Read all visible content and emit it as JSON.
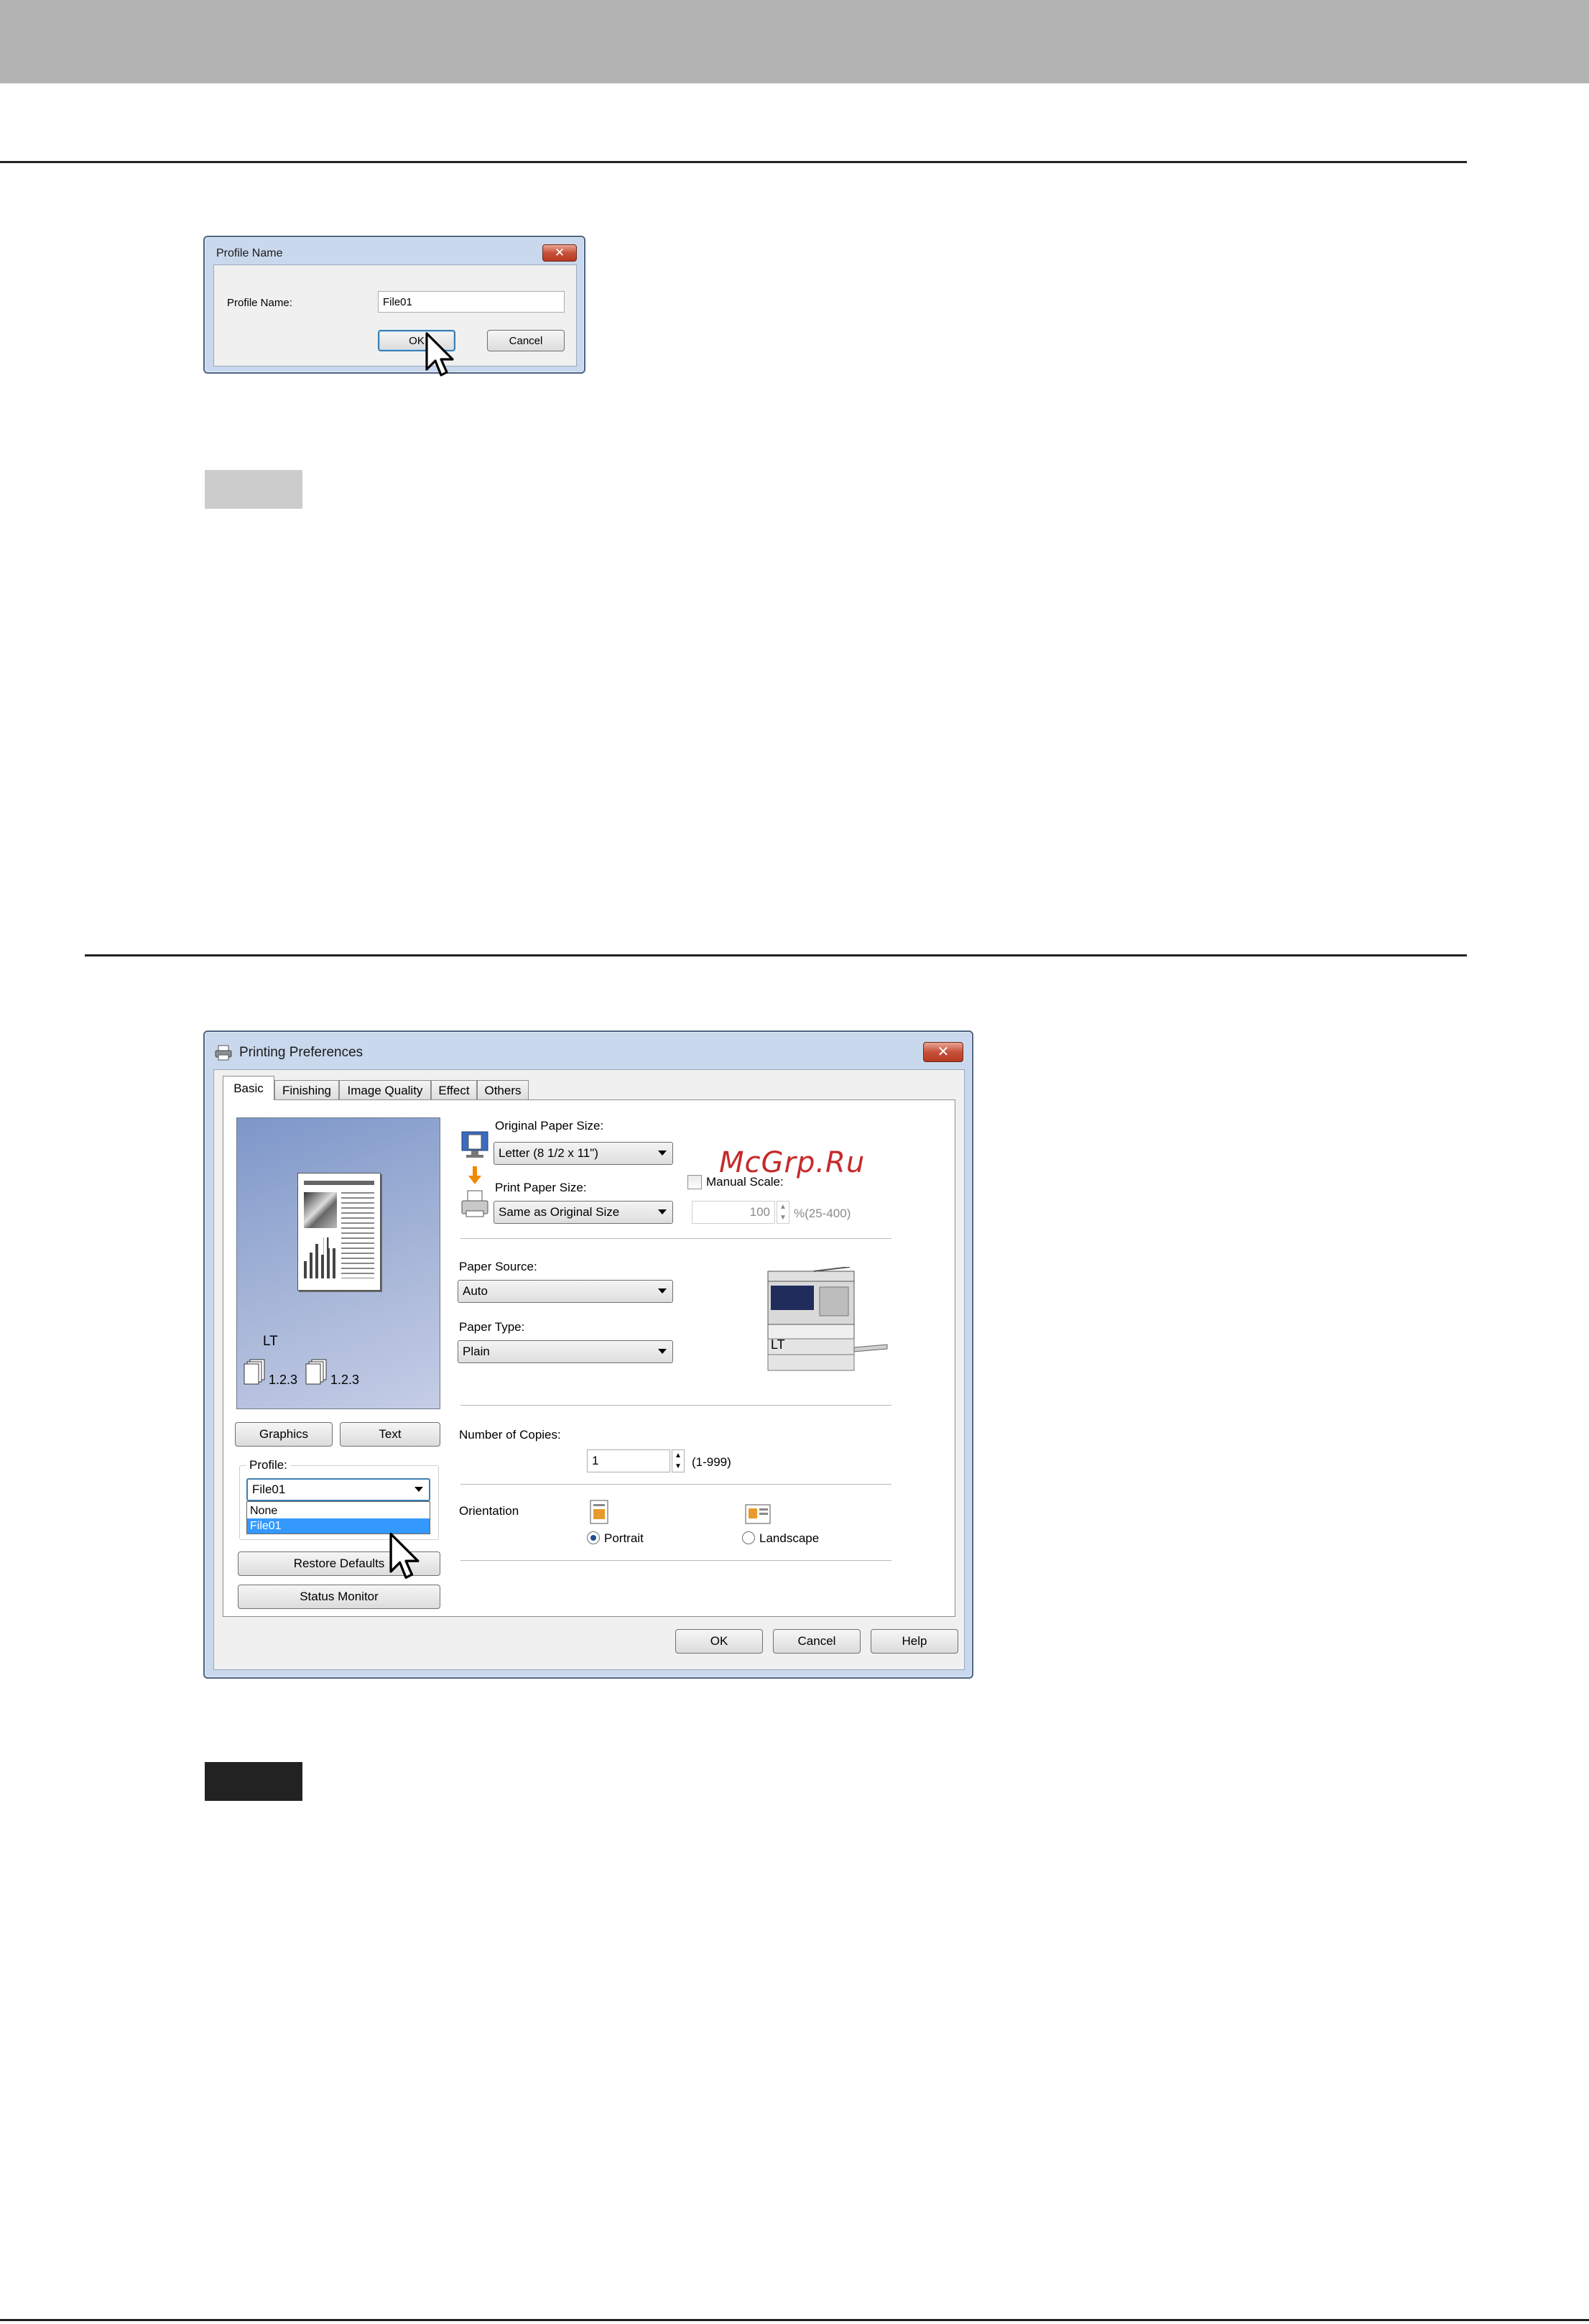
{
  "profile_name_dialog": {
    "title": "Profile Name",
    "close_glyph": "✕",
    "label": "Profile Name:",
    "value": "File01",
    "ok_label": "OK",
    "cancel_label": "Cancel"
  },
  "printing_prefs": {
    "title": "Printing Preferences",
    "close_glyph": "✕",
    "tabs": [
      "Basic",
      "Finishing",
      "Image Quality",
      "Effect",
      "Others"
    ],
    "preview": {
      "paper_code": "LT",
      "order_left": "1.2.3",
      "order_right": "1.2.3"
    },
    "graphics_label": "Graphics",
    "text_label": "Text",
    "profile": {
      "group_label": "Profile:",
      "selected": "File01",
      "options": [
        "None",
        "File01"
      ]
    },
    "restore_defaults_label": "Restore Defaults",
    "status_monitor_label": "Status Monitor",
    "original_paper_size": {
      "label": "Original Paper Size:",
      "value": "Letter (8 1/2 x 11\")"
    },
    "print_paper_size": {
      "label": "Print Paper Size:",
      "value": "Same as Original Size"
    },
    "manual_scale": {
      "label": "Manual Scale:",
      "value": "100",
      "range": "%(25-400)"
    },
    "paper_source": {
      "label": "Paper Source:",
      "value": "Auto"
    },
    "paper_type": {
      "label": "Paper Type:",
      "value": "Plain"
    },
    "device_paper_code": "LT",
    "copies": {
      "label": "Number of Copies:",
      "value": "1",
      "range": "(1-999)"
    },
    "orientation": {
      "label": "Orientation",
      "portrait": "Portrait",
      "landscape": "Landscape"
    },
    "ok_label": "OK",
    "cancel_label": "Cancel",
    "help_label": "Help"
  },
  "watermark_text": "McGrp.Ru",
  "colors": {
    "header_band": "#b3b3b3",
    "note_box_light": "#cccccc",
    "note_box_dark": "#222222",
    "watermark": "#c62a2a"
  }
}
